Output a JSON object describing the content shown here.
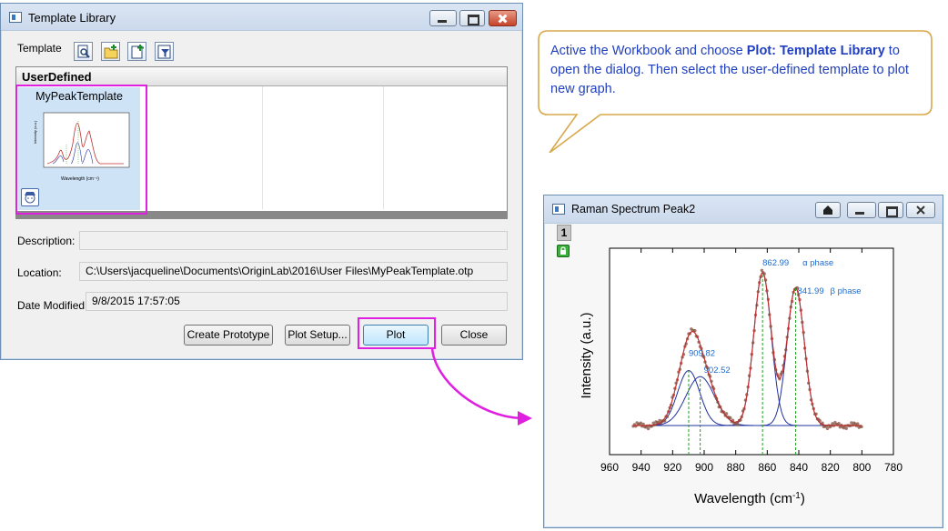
{
  "dialog": {
    "title": "Template Library",
    "toolbar_label": "Template",
    "category": "UserDefined",
    "template_name": "MyPeakTemplate",
    "description_label": "Description:",
    "description_value": "",
    "location_label": "Location:",
    "location_value": "C:\\Users\\jacqueline\\Documents\\OriginLab\\2016\\User Files\\MyPeakTemplate.otp",
    "date_label": "Date Modified:",
    "date_value": "9/8/2015 17:57:05",
    "buttons": {
      "create_prototype": "Create Prototype",
      "plot_setup": "Plot Setup...",
      "plot": "Plot",
      "close": "Close"
    }
  },
  "callout": {
    "part1": "Active the Workbook and choose ",
    "bold": "Plot: Template Library",
    "part2": " to open the dialog. Then select the user-defined template to plot new graph."
  },
  "graph_window": {
    "title": "Raman Spectrum Peak2",
    "layer_number": "1"
  },
  "chart_data": {
    "type": "line",
    "xlabel": "Wavelength (cm",
    "xlabel_sup": "-1",
    "xlabel_end": ")",
    "ylabel": "Intensity (a.u.)",
    "xlim": [
      960,
      780
    ],
    "x_reversed": true,
    "x_ticks": [
      960,
      940,
      920,
      900,
      880,
      860,
      840,
      820,
      800,
      780
    ],
    "x_range_data": [
      945,
      800
    ],
    "series": [
      {
        "kind": "scatter-data",
        "color": "#8a5a4a"
      },
      {
        "kind": "cumulative-fit",
        "color": "#c03030"
      },
      {
        "kind": "peak-fit",
        "color": "#2030a0"
      }
    ],
    "peaks": [
      {
        "center": 909.82,
        "label": "909.82",
        "height": 0.36,
        "width": 7
      },
      {
        "center": 902.52,
        "label": "902.52",
        "height": 0.32,
        "width": 9
      },
      {
        "center": 862.99,
        "label": "862.99",
        "height": 1.0,
        "width": 5.5
      },
      {
        "center": 841.99,
        "label": "841.99",
        "height": 0.9,
        "width": 5.5
      }
    ],
    "phase_labels": {
      "alpha": "α phase",
      "beta": "β phase"
    },
    "dropline_color": "#20a020"
  }
}
